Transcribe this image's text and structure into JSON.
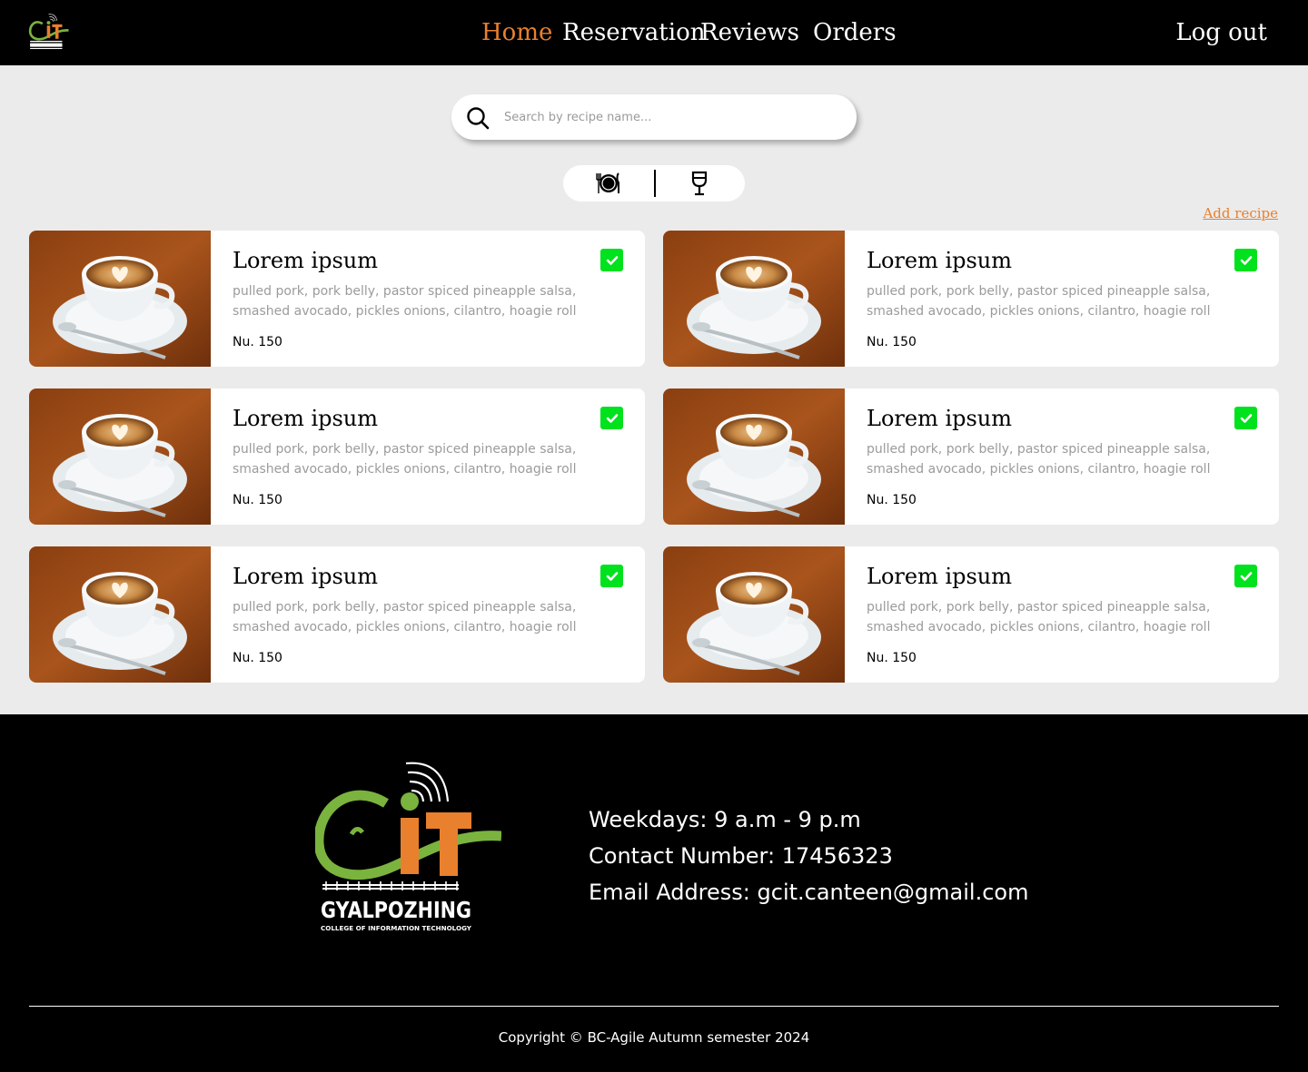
{
  "nav": {
    "logo_text": "GYALPOZHING",
    "links": [
      "Home",
      "Reservation",
      "Reviews",
      "Orders"
    ],
    "logout": "Log out"
  },
  "colors": {
    "accent": "#e8802e",
    "check_green": "#00e21e",
    "logo_green": "#7ab33e"
  },
  "search": {
    "placeholder": "Search by recipe name..."
  },
  "categories": {
    "food_icon": "plate-utensils-icon",
    "drink_icon": "wine-glass-icon"
  },
  "add_recipe": "Add recipe",
  "recipes": [
    {
      "title": "Lorem ipsum",
      "description": "pulled pork, pork belly, pastor spiced pineapple salsa, smashed avocado, pickles onions, cilantro, hoagie roll",
      "price": "Nu. 150",
      "checked": true
    },
    {
      "title": "Lorem ipsum",
      "description": "pulled pork, pork belly, pastor spiced pineapple salsa, smashed avocado, pickles onions, cilantro, hoagie roll",
      "price": "Nu. 150",
      "checked": true
    },
    {
      "title": "Lorem ipsum",
      "description": "pulled pork, pork belly, pastor spiced pineapple salsa, smashed avocado, pickles onions, cilantro, hoagie roll",
      "price": "Nu. 150",
      "checked": true
    },
    {
      "title": "Lorem ipsum",
      "description": "pulled pork, pork belly, pastor spiced pineapple salsa, smashed avocado, pickles onions, cilantro, hoagie roll",
      "price": "Nu. 150",
      "checked": true
    },
    {
      "title": "Lorem ipsum",
      "description": "pulled pork, pork belly, pastor spiced pineapple salsa, smashed avocado, pickles onions, cilantro, hoagie roll",
      "price": "Nu. 150",
      "checked": true
    },
    {
      "title": "Lorem ipsum",
      "description": "pulled pork, pork belly, pastor spiced pineapple salsa, smashed avocado, pickles onions, cilantro, hoagie roll",
      "price": "Nu. 150",
      "checked": true
    }
  ],
  "footer": {
    "logo_name": "GYALPOZHING",
    "logo_subtitle": "COLLEGE OF INFORMATION TECHNOLOGY",
    "hours": "Weekdays: 9 a.m - 9 p.m",
    "contact": "Contact Number: 17456323",
    "email": "Email Address: gcit.canteen@gmail.com",
    "copyright": "Copyright © BC-Agile Autumn semester 2024"
  }
}
